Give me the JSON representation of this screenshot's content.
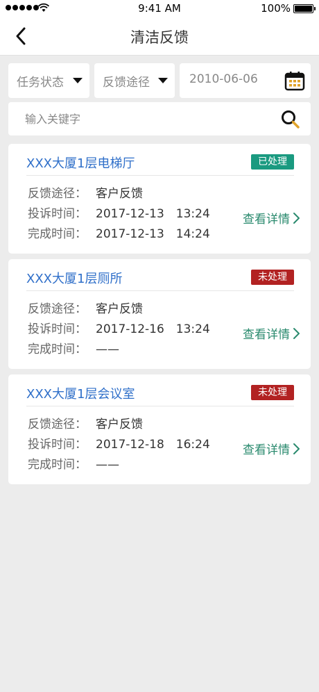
{
  "status_bar": {
    "time": "9:41 AM",
    "battery": "100%"
  },
  "nav": {
    "title": "清洁反馈"
  },
  "filters": {
    "task_status": "任务状态",
    "channel": "反馈途径",
    "date": "2010-06-06"
  },
  "search": {
    "placeholder": "输入关键字"
  },
  "labels": {
    "channel": "反馈途径：",
    "complain_time": "投诉时间：",
    "finish_time": "完成时间：",
    "detail": "查看详情"
  },
  "records": [
    {
      "title": "XXX大厦1层电梯厅",
      "status": "已处理",
      "channel": "客户反馈",
      "complain_time": "2017-12-13　13:24",
      "finish_time": "2017-12-13　14:24"
    },
    {
      "title": "XXX大厦1层厕所",
      "status": "未处理",
      "channel": "客户反馈",
      "complain_time": "2017-12-16　13:24",
      "finish_time": "——"
    },
    {
      "title": "XXX大厦1层会议室",
      "status": "未处理",
      "channel": "客户反馈",
      "complain_time": "2017-12-18　16:24",
      "finish_time": "——"
    }
  ],
  "colors": {
    "title_blue": "#2f6fc9",
    "badge_done": "#1a9a80",
    "badge_todo": "#b22222",
    "link_green": "#2a8a6e"
  }
}
